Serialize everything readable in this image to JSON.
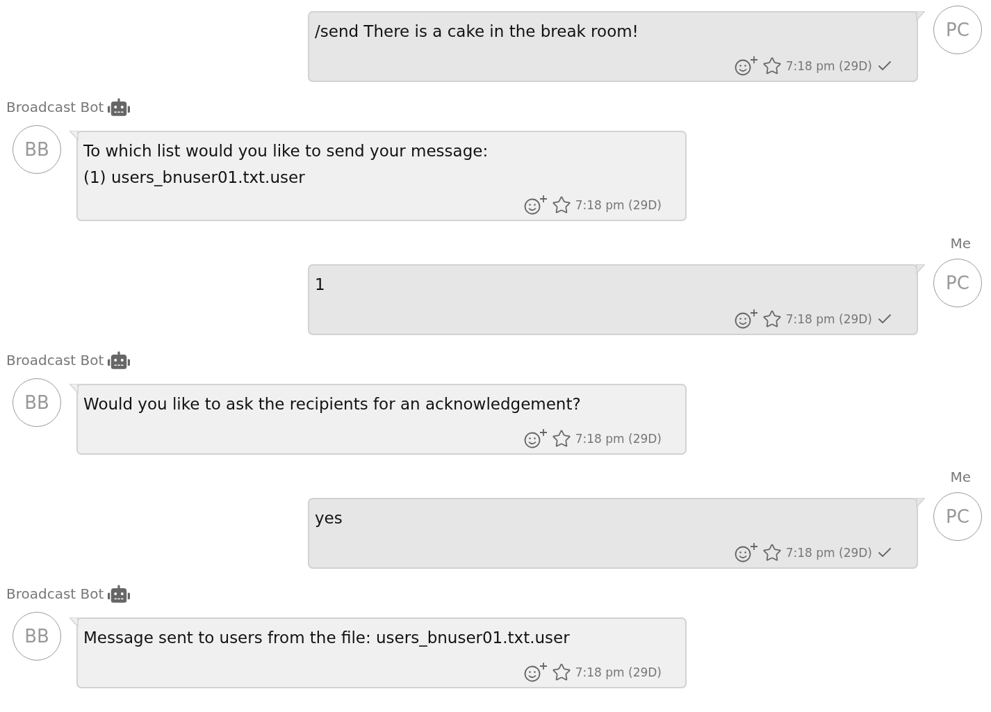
{
  "messages": [
    {
      "kind": "sent",
      "avatar": "PC",
      "text": "/send There is a cake in the break room!",
      "time": "7:18 pm (29D)",
      "delivered": true,
      "starred": false
    },
    {
      "kind": "received",
      "sender": "Broadcast Bot",
      "bot": true,
      "avatar": "BB",
      "text": "To which list would you like to send your message:\n(1) users_bnuser01.txt.user",
      "time": "7:18 pm (29D)",
      "starred": false
    },
    {
      "kind": "sent",
      "sender": "Me",
      "avatar": "PC",
      "text": "1",
      "time": "7:18 pm (29D)",
      "delivered": true,
      "starred": false
    },
    {
      "kind": "received",
      "sender": "Broadcast Bot",
      "bot": true,
      "avatar": "BB",
      "text": "Would you like to ask the recipients for an acknowledgement?",
      "time": "7:18 pm (29D)",
      "starred": false
    },
    {
      "kind": "sent",
      "sender": "Me",
      "avatar": "PC",
      "text": "yes",
      "time": "7:18 pm (29D)",
      "delivered": true,
      "starred": false
    },
    {
      "kind": "received",
      "sender": "Broadcast Bot",
      "bot": true,
      "avatar": "BB",
      "text": "Message sent to users from the file: users_bnuser01.txt.user",
      "time": "7:18 pm (29D)",
      "starred": false
    }
  ]
}
